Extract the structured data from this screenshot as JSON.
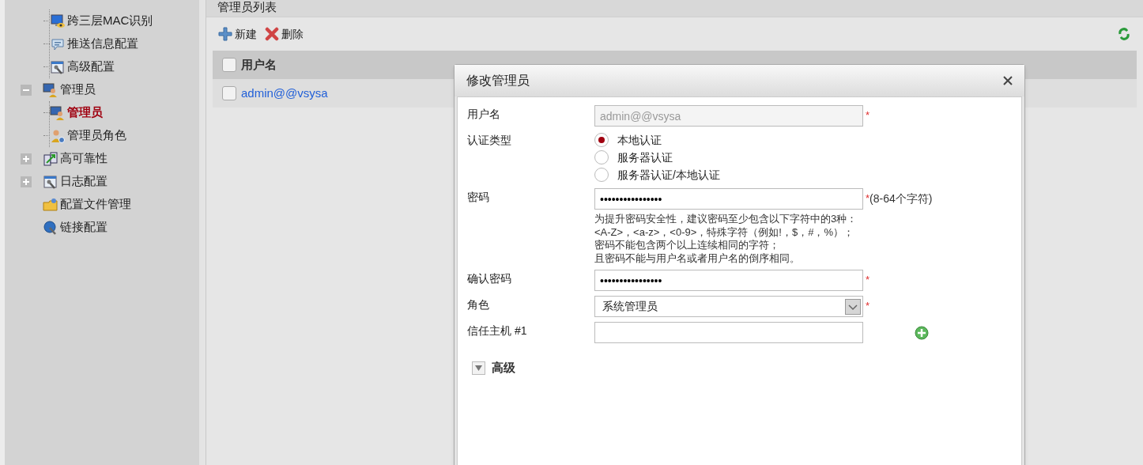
{
  "sidebar": {
    "partial_children": [
      {
        "label": "跨三层MAC识别",
        "selected": false
      },
      {
        "label": "推送信息配置",
        "selected": false
      },
      {
        "label": "高级配置",
        "selected": false
      }
    ],
    "items": [
      {
        "label": "管理员",
        "selected": false,
        "expanded": true,
        "children": [
          {
            "label": "管理员",
            "selected": true
          },
          {
            "label": "管理员角色",
            "selected": false
          }
        ]
      },
      {
        "label": "高可靠性",
        "selected": false,
        "expanded": false
      },
      {
        "label": "日志配置",
        "selected": false,
        "expanded": false
      },
      {
        "label": "配置文件管理",
        "selected": false
      },
      {
        "label": "链接配置",
        "selected": false
      }
    ]
  },
  "main": {
    "title": "管理员列表",
    "toolbar": [
      {
        "kind": "add",
        "label": "新建"
      },
      {
        "kind": "delete",
        "label": "删除"
      }
    ],
    "table": {
      "columns": [
        "用户名"
      ],
      "header_checked": false,
      "rows": [
        {
          "checked": false,
          "username": "admin@@vsysa"
        }
      ]
    }
  },
  "dialog": {
    "title": "修改管理员",
    "fields": [
      {
        "kind": "text",
        "label": "用户名",
        "value": "admin@@vsysa",
        "disabled": true,
        "required_mark": "*"
      },
      {
        "kind": "radio",
        "label": "认证类型",
        "options": [
          {
            "label": "本地认证",
            "selected": true
          },
          {
            "label": "服务器认证",
            "selected": false
          },
          {
            "label": "服务器认证/本地认证",
            "selected": false
          }
        ]
      },
      {
        "kind": "password",
        "label": "密码",
        "value": "••••••••••••••••",
        "required_mark": "*",
        "note": "(8-64个字符)",
        "help": [
          "为提升密码安全性，建议密码至少包含以下字符中的3种：",
          "<A-Z>，<a-z>，<0-9>，特殊字符（例如!，$，#，%）；",
          "密码不能包含两个以上连续相同的字符；",
          "且密码不能与用户名或者用户名的倒序相同。"
        ]
      },
      {
        "kind": "password",
        "label": "确认密码",
        "value": "••••••••••••••••",
        "required_mark": "*"
      },
      {
        "kind": "select",
        "label": "角色",
        "value": "系统管理员",
        "required_mark": "*"
      },
      {
        "kind": "add",
        "label": "信任主机 #1"
      }
    ],
    "advanced": {
      "label": "高级",
      "expanded": false
    }
  }
}
